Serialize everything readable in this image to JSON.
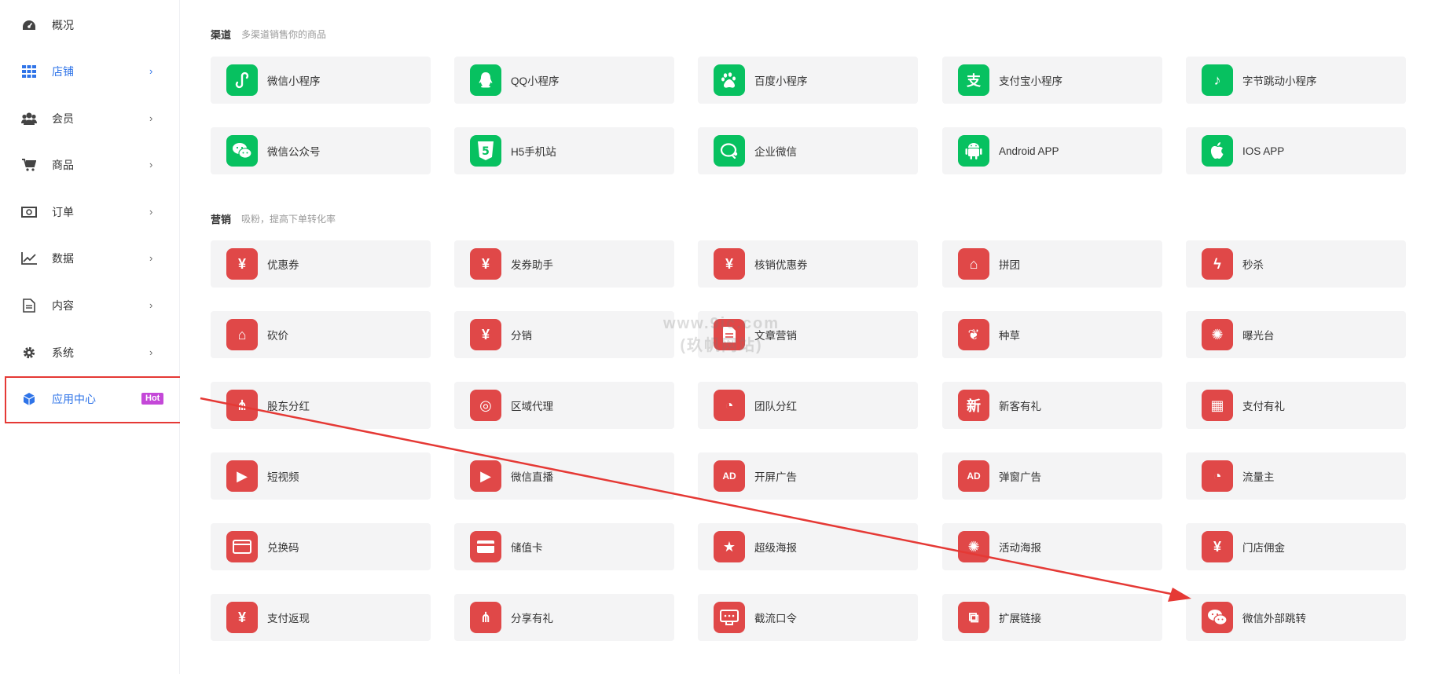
{
  "sidebar": {
    "items": [
      {
        "label": "概况",
        "icon": "dashboard-icon",
        "chevron": ""
      },
      {
        "label": "店铺",
        "icon": "grid-icon",
        "chevron": "›"
      },
      {
        "label": "会员",
        "icon": "users-icon",
        "chevron": "›"
      },
      {
        "label": "商品",
        "icon": "cart-icon",
        "chevron": "›"
      },
      {
        "label": "订单",
        "icon": "money-icon",
        "chevron": "›"
      },
      {
        "label": "数据",
        "icon": "chart-line-icon",
        "chevron": "›"
      },
      {
        "label": "内容",
        "icon": "document-icon",
        "chevron": "›"
      },
      {
        "label": "系统",
        "icon": "gear-icon",
        "chevron": "›"
      },
      {
        "label": "应用中心",
        "icon": "cube-icon",
        "badge": "Hot"
      }
    ]
  },
  "channels": {
    "title": "渠道",
    "subtitle": "多渠道销售你的商品",
    "items": [
      {
        "label": "微信小程序",
        "icon": "mini-program-icon"
      },
      {
        "label": "QQ小程序",
        "icon": "qq-icon"
      },
      {
        "label": "百度小程序",
        "icon": "baidu-icon"
      },
      {
        "label": "支付宝小程序",
        "icon": "alipay-icon"
      },
      {
        "label": "字节跳动小程序",
        "icon": "tiktok-icon"
      },
      {
        "label": "微信公众号",
        "icon": "wechat-icon"
      },
      {
        "label": "H5手机站",
        "icon": "html5-icon"
      },
      {
        "label": "企业微信",
        "icon": "wecom-icon"
      },
      {
        "label": "Android APP",
        "icon": "android-icon"
      },
      {
        "label": "IOS APP",
        "icon": "apple-icon"
      }
    ]
  },
  "marketing": {
    "title": "营销",
    "subtitle": "吸粉，提高下单转化率",
    "items": [
      {
        "label": "优惠券",
        "icon": "coupon-icon"
      },
      {
        "label": "发券助手",
        "icon": "coupon-send-icon"
      },
      {
        "label": "核销优惠券",
        "icon": "coupon-verify-icon"
      },
      {
        "label": "拼团",
        "icon": "group-buy-icon"
      },
      {
        "label": "秒杀",
        "icon": "flash-icon"
      },
      {
        "label": "砍价",
        "icon": "bargain-icon"
      },
      {
        "label": "分销",
        "icon": "money-bag-icon"
      },
      {
        "label": "文章营销",
        "icon": "article-icon"
      },
      {
        "label": "种草",
        "icon": "sprout-icon"
      },
      {
        "label": "曝光台",
        "icon": "sun-icon"
      },
      {
        "label": "股东分红",
        "icon": "share-hand-icon"
      },
      {
        "label": "区域代理",
        "icon": "database-icon"
      },
      {
        "label": "团队分红",
        "icon": "pie-icon"
      },
      {
        "label": "新客有礼",
        "icon": "new-icon"
      },
      {
        "label": "支付有礼",
        "icon": "gift-icon"
      },
      {
        "label": "短视频",
        "icon": "video-icon"
      },
      {
        "label": "微信直播",
        "icon": "live-icon"
      },
      {
        "label": "开屏广告",
        "icon": "ad-splash-icon"
      },
      {
        "label": "弹窗广告",
        "icon": "ad-popup-icon"
      },
      {
        "label": "流量主",
        "icon": "traffic-icon"
      },
      {
        "label": "兑换码",
        "icon": "redeem-icon"
      },
      {
        "label": "储值卡",
        "icon": "card-icon"
      },
      {
        "label": "超级海报",
        "icon": "poster-star-icon"
      },
      {
        "label": "活动海报",
        "icon": "poster-icon"
      },
      {
        "label": "门店佣金",
        "icon": "commission-icon"
      },
      {
        "label": "支付返现",
        "icon": "cashback-icon"
      },
      {
        "label": "分享有礼",
        "icon": "share-gift-icon"
      },
      {
        "label": "截流口令",
        "icon": "password-icon"
      },
      {
        "label": "扩展链接",
        "icon": "link-icon"
      },
      {
        "label": "微信外部跳转",
        "icon": "wechat-jump-icon"
      }
    ]
  },
  "glyphs": {
    "qq": "◖",
    "html5": "5",
    "baidu": "❀",
    "alipay": "支",
    "tiktok": "♪",
    "wechat": "◕",
    "wecom": "◌",
    "android": "▣",
    "apple": "●",
    "coupon": "¥",
    "flash": "ϟ",
    "new": "新",
    "gift": "▦",
    "pie": "◔",
    "sun": "✺",
    "ad": "AD",
    "star": "★",
    "link": "⧉",
    "yen": "¥",
    "video": "▶",
    "sprout": "❦",
    "tag": "⌂",
    "db": "◎",
    "share": "⋔",
    "chat": "◔"
  },
  "watermark": {
    "line1": "www.9ic.com",
    "line2": "(玖帆网站)"
  },
  "colors": {
    "green": "#07c160",
    "red": "#e04848",
    "accent": "#2f74e8",
    "badge": "#c448d8",
    "annotation": "#e53935"
  }
}
